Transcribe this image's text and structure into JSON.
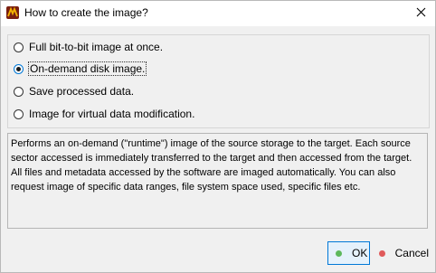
{
  "window": {
    "title": "How to create the image?"
  },
  "options": [
    {
      "label": "Full bit-to-bit image at once.",
      "checked": false
    },
    {
      "label": "On-demand disk image.",
      "checked": true
    },
    {
      "label": "Save processed data.",
      "checked": false
    },
    {
      "label": "Image for virtual data modification.",
      "checked": false
    }
  ],
  "description": "Performs an on-demand (\"runtime\") image of the source storage to the target. Each source sector accessed is immediately transferred to the target and then accessed from the target. All files and metadata accessed by the software are imaged automatically. You can also request image of specific data ranges, file system space used, specific files etc.",
  "buttons": {
    "ok_label": "OK",
    "cancel_label": "Cancel"
  },
  "colors": {
    "ok_dot": "#5cb85c",
    "cancel_dot": "#e05a5a",
    "accent": "#0078d7"
  },
  "icons": {
    "app": "app-logo-icon",
    "close": "close-icon"
  }
}
